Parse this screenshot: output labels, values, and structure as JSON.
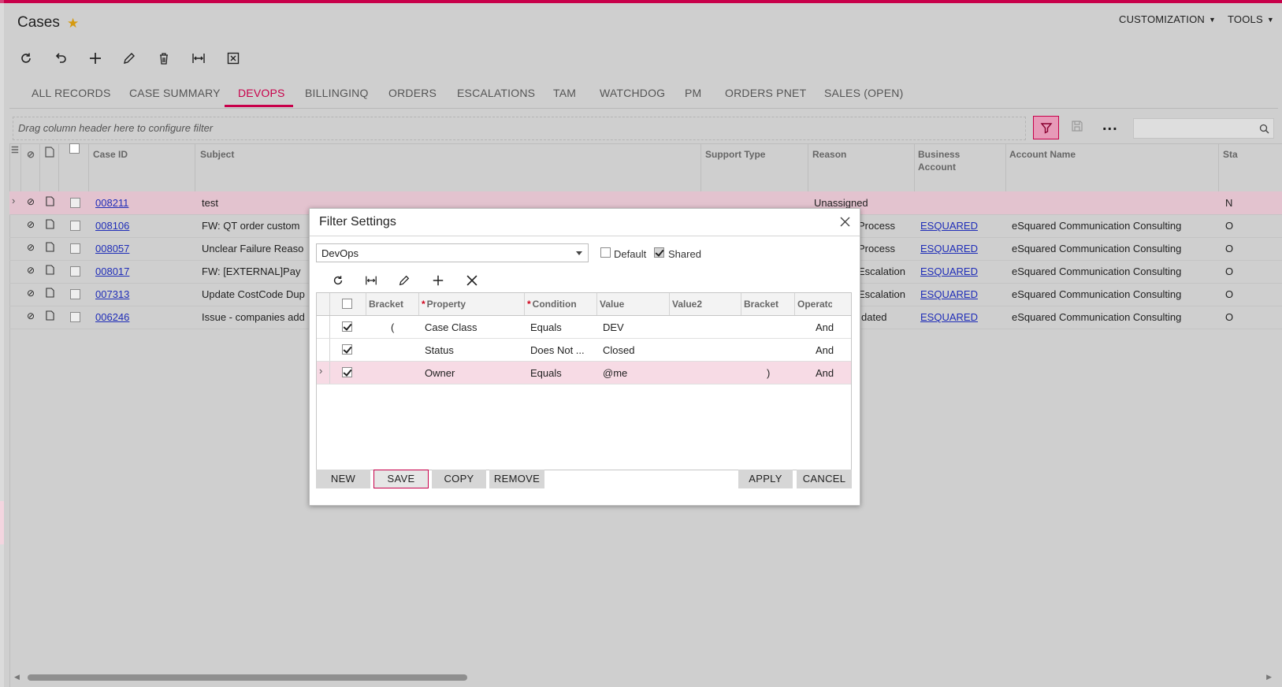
{
  "page": {
    "title": "Cases"
  },
  "header": {
    "customization_label": "CUSTOMIZATION",
    "tools_label": "TOOLS"
  },
  "tabs": [
    {
      "label": "ALL RECORDS"
    },
    {
      "label": "CASE SUMMARY"
    },
    {
      "label": "DEVOPS",
      "active": true
    },
    {
      "label": "BILLINGINQ"
    },
    {
      "label": "ORDERS"
    },
    {
      "label": "ESCALATIONS"
    },
    {
      "label": "TAM"
    },
    {
      "label": "WATCHDOG"
    },
    {
      "label": "PM"
    },
    {
      "label": "ORDERS PNET"
    },
    {
      "label": "SALES (OPEN)"
    }
  ],
  "filter_bar": {
    "placeholder": "Drag column header here to configure filter"
  },
  "grid": {
    "columns": [
      "Case ID",
      "Subject",
      "Support Type",
      "Reason",
      "Business Account",
      "Account Name",
      "Sta"
    ],
    "business_account_line1": "Business",
    "business_account_line2": "Account",
    "rows": [
      {
        "case_id": "008211",
        "subject": "test",
        "reason": "Unassigned",
        "business_account": "",
        "account_name": "",
        "status": "N"
      },
      {
        "case_id": "008106",
        "subject": "FW: QT order custom",
        "reason": "Process",
        "business_account": "ESQUARED",
        "account_name": "eSquared Communication Consulting",
        "status": "O"
      },
      {
        "case_id": "008057",
        "subject": "Unclear Failure Reaso",
        "reason": "Process",
        "business_account": "ESQUARED",
        "account_name": "eSquared Communication Consulting",
        "status": "O"
      },
      {
        "case_id": "008017",
        "subject": "FW: [EXTERNAL]Pay",
        "reason": "Escalation",
        "business_account": "ESQUARED",
        "account_name": "eSquared Communication Consulting",
        "status": "O"
      },
      {
        "case_id": "007313",
        "subject": "Update CostCode Dup",
        "reason": "Escalation",
        "business_account": "ESQUARED",
        "account_name": "eSquared Communication Consulting",
        "status": "O"
      },
      {
        "case_id": "006246",
        "subject": "Issue - companies add",
        "reason": "dated",
        "business_account": "ESQUARED",
        "account_name": "eSquared Communication Consulting",
        "status": "O"
      }
    ]
  },
  "dialog": {
    "title": "Filter Settings",
    "filter_name": "DevOps",
    "default_label": "Default",
    "shared_label": "Shared",
    "default_checked": false,
    "shared_checked": true,
    "columns": {
      "bracket_open": "Bracket",
      "property": "Property",
      "condition": "Condition",
      "value": "Value",
      "value2": "Value2",
      "bracket_close": "Bracket",
      "operator": "Operatc"
    },
    "rows": [
      {
        "checked": true,
        "bracket_open": "(",
        "property": "Case Class",
        "condition": "Equals",
        "value": "DEV",
        "value2": "",
        "bracket_close": "",
        "operator": "And"
      },
      {
        "checked": true,
        "bracket_open": "",
        "property": "Status",
        "condition": "Does Not ...",
        "value": "Closed",
        "value2": "",
        "bracket_close": "",
        "operator": "And"
      },
      {
        "checked": true,
        "bracket_open": "",
        "property": "Owner",
        "condition": "Equals",
        "value": "@me",
        "value2": "",
        "bracket_close": ")",
        "operator": "And"
      }
    ],
    "buttons": {
      "new": "NEW",
      "save": "SAVE",
      "copy": "COPY",
      "remove": "REMOVE",
      "apply": "APPLY",
      "cancel": "CANCEL"
    }
  },
  "colors": {
    "accent": "#c8004a",
    "link": "#1f2db8",
    "star": "#d59a10"
  }
}
